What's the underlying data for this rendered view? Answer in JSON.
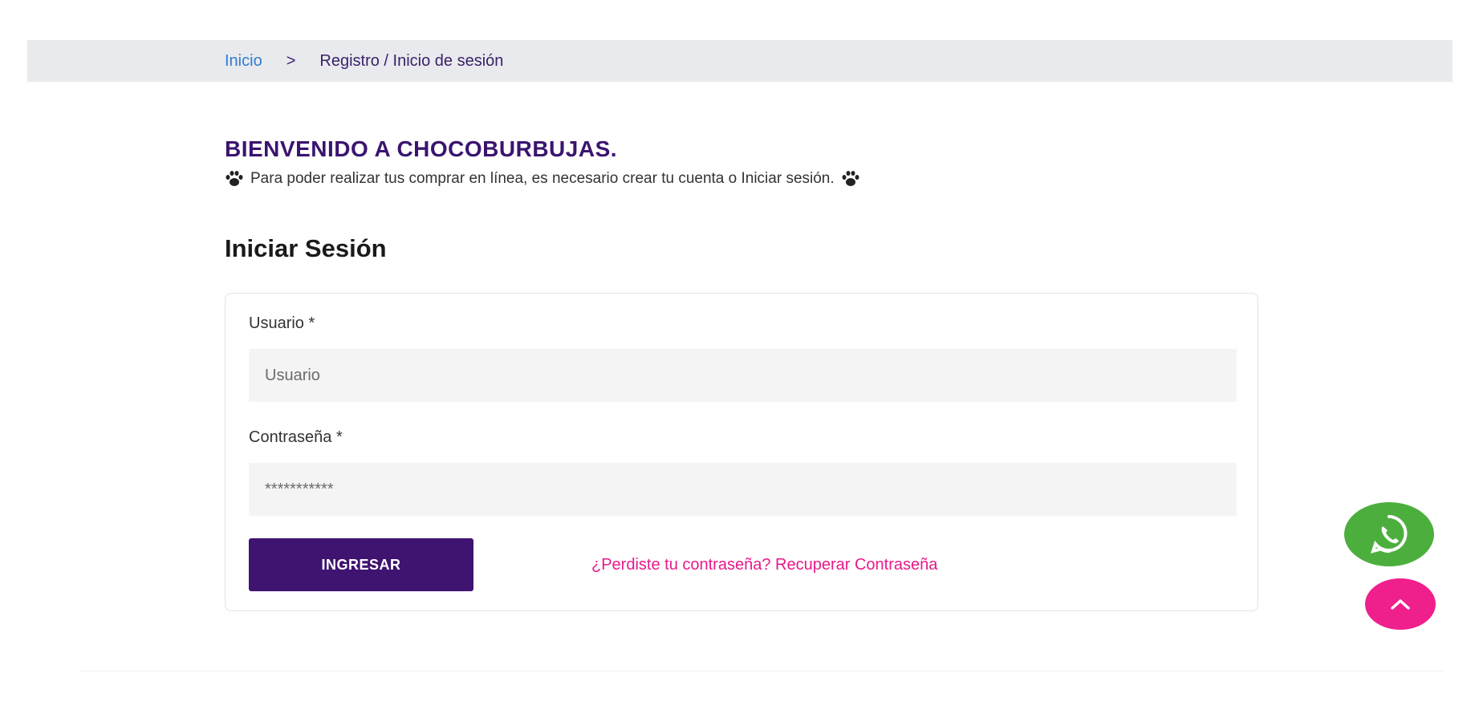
{
  "breadcrumb": {
    "home": "Inicio",
    "separator": ">",
    "current": "Registro / Inicio de sesión"
  },
  "welcome": {
    "title": "BIENVENIDO A CHOCOBURBUJAS.",
    "text": "Para poder realizar tus comprar en línea, es necesario crear tu cuenta o Iniciar sesión.",
    "decor_icon": "paw-icon"
  },
  "login": {
    "heading": "Iniciar Sesión",
    "username_label": "Usuario *",
    "username_placeholder": "Usuario",
    "password_label": "Contraseña *",
    "password_placeholder": "***********",
    "submit_label": "INGRESAR",
    "recover_link": "¿Perdiste tu contraseña? Recuperar Contraseña"
  },
  "floating": {
    "whatsapp_icon": "whatsapp-icon",
    "scroll_top_icon": "chevron-up-icon"
  },
  "colors": {
    "brand_purple": "#3f1370",
    "accent_pink": "#e8198b",
    "whatsapp_green": "#4caf3d",
    "link_blue": "#2f7bd1",
    "breadcrumb_bg": "#e9eaed"
  }
}
